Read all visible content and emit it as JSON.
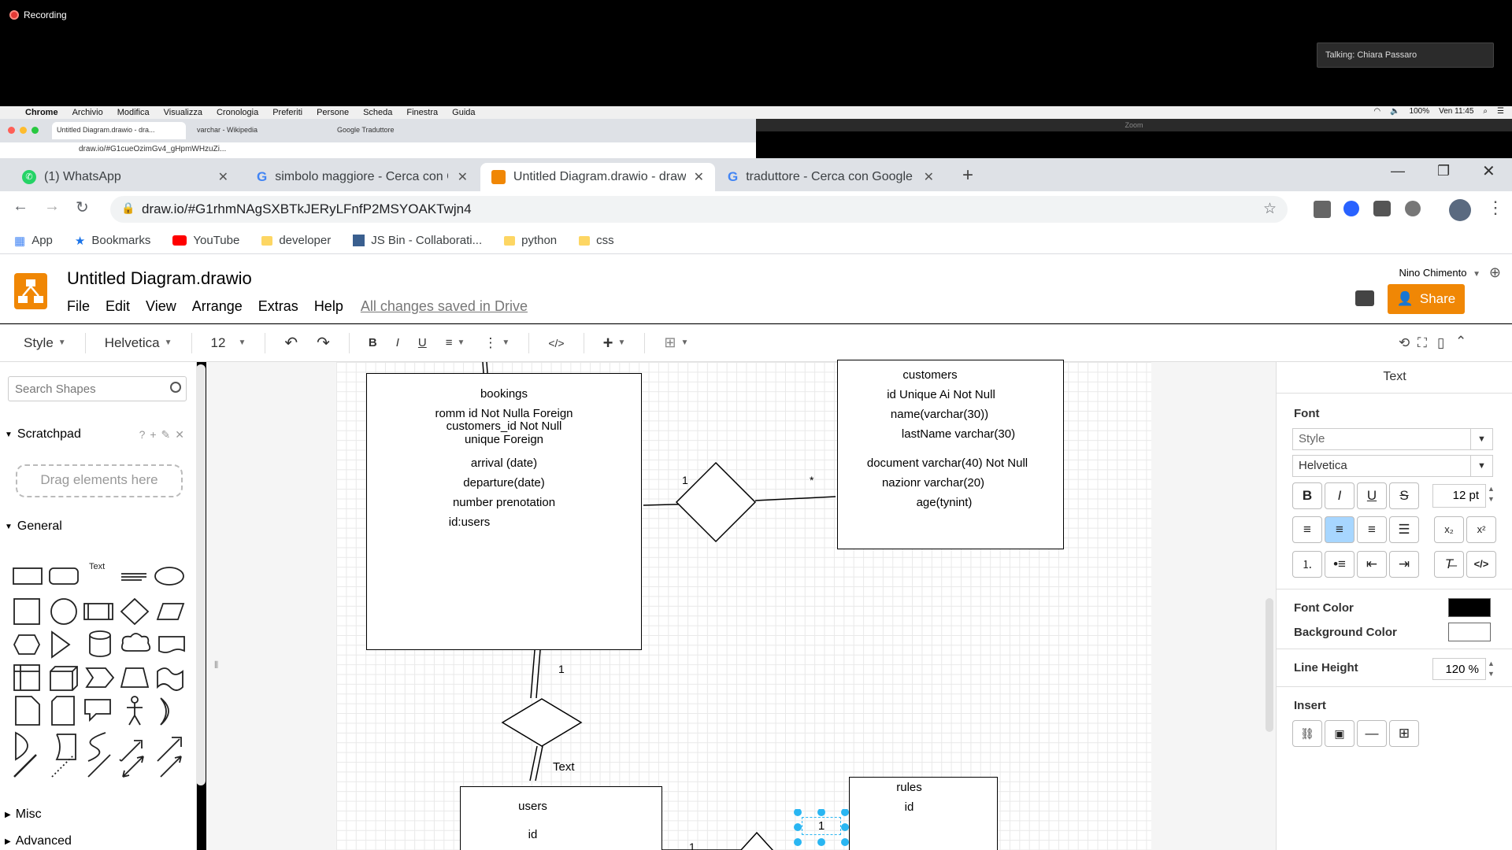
{
  "recording": {
    "label": "Recording"
  },
  "talking": {
    "label": "Talking: Chiara Passaro"
  },
  "macbar": {
    "items": [
      "Chrome",
      "Archivio",
      "Modifica",
      "Visualizza",
      "Cronologia",
      "Preferiti",
      "Persone",
      "Scheda",
      "Finestra",
      "Guida"
    ],
    "battery": "100%",
    "clock": "Ven 11:45"
  },
  "small_chrome": {
    "tabs": [
      "Untitled Diagram.drawio - dra...",
      "varchar - Wikipedia",
      "Google Traduttore"
    ],
    "url": "draw.io/#G1cueOzimGv4_gHpmWHzuZi...",
    "zoom_title": "Zoom"
  },
  "chrome": {
    "tabs": [
      {
        "label": "(1) WhatsApp"
      },
      {
        "label": "simbolo maggiore - Cerca con G"
      },
      {
        "label": "Untitled Diagram.drawio - draw.i"
      },
      {
        "label": "traduttore - Cerca con Google"
      }
    ],
    "url": "draw.io/#G1rhmNAgSXBTkJERyLFnfP2MSYOAKTwjn4",
    "bookmarks": [
      "App",
      "Bookmarks",
      "YouTube",
      "developer",
      "JS Bin - Collaborati...",
      "python",
      "css"
    ]
  },
  "drawio": {
    "title": "Untitled Diagram.drawio",
    "menu": [
      "File",
      "Edit",
      "View",
      "Arrange",
      "Extras",
      "Help"
    ],
    "saved": "All changes saved in Drive",
    "user": "Nino Chimento",
    "share": "Share",
    "toolbar": {
      "style": "Style",
      "font": "Helvetica",
      "size": "12"
    }
  },
  "left": {
    "search_placeholder": "Search Shapes",
    "scratchpad": "Scratchpad",
    "drag": "Drag elements here",
    "general": "General",
    "text_shape": "Text",
    "misc": "Misc",
    "advanced": "Advanced"
  },
  "diagram": {
    "bookings": [
      "bookings",
      "romm id Not Nulla Foreign",
      "customers_id Not Null",
      "unique Foreign",
      "arrival (date)",
      "departure(date)",
      "number prenotation",
      "id:users"
    ],
    "customers": [
      "customers",
      "id Unique Ai Not Null",
      "name(varchar(30))",
      "lastName varchar(30)",
      "document varchar(40) Not Null",
      "nazionr varchar(20)",
      "age(tynint)"
    ],
    "users": [
      "users",
      "id"
    ],
    "rules": [
      "rules",
      "id"
    ],
    "labels": {
      "one_a": "1",
      "star": "*",
      "one_b": "1",
      "text": "Text",
      "one_c": "1",
      "selected": "1"
    }
  },
  "right": {
    "tab": "Text",
    "font_label": "Font",
    "style_value": "Style",
    "font_value": "Helvetica",
    "size_value": "12 pt",
    "font_color_label": "Font Color",
    "bg_color_label": "Background Color",
    "line_height_label": "Line Height",
    "line_height_value": "120 %",
    "insert_label": "Insert",
    "colors": {
      "font": "#000000",
      "background": "#ffffff"
    }
  }
}
